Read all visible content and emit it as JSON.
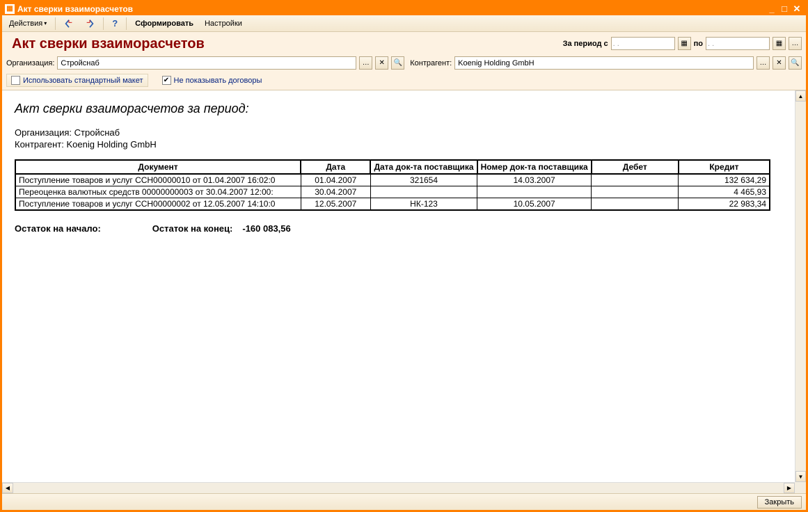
{
  "window": {
    "title": "Акт сверки взаиморасчетов"
  },
  "toolbar": {
    "actions": "Действия",
    "generate": "Сформировать",
    "settings": "Настройки"
  },
  "header": {
    "report_title": "Акт сверки взаиморасчетов",
    "period_label": "За период с",
    "po_label": "по",
    "date_from": "  .  .",
    "date_to": "  .  ."
  },
  "fields": {
    "org_label": "Организация:",
    "org_value": "Стройснаб",
    "contr_label": "Контрагент:",
    "contr_value": "Koenig Holding GmbH"
  },
  "checks": {
    "std_layout": "Использовать стандартный макет",
    "hide_contracts": "Не показывать договоры"
  },
  "report": {
    "title": "Акт сверки взаиморасчетов за период:",
    "org_line_label": "Организация:",
    "org_line_value": "Стройснаб",
    "contr_line_label": "Контрагент:",
    "contr_line_value": "Koenig Holding GmbH",
    "columns": {
      "doc": "Документ",
      "date": "Дата",
      "sup_date": "Дата док-та поставщика",
      "sup_num": "Номер док-та поставщика",
      "debit": "Дебет",
      "credit": "Кредит"
    },
    "rows": [
      {
        "doc": "Поступление товаров и услуг ССН00000010 от 01.04.2007 16:02:0",
        "date": "01.04.2007",
        "sup_date": "321654",
        "sup_num": "14.03.2007",
        "debit": "",
        "credit": "132 634,29"
      },
      {
        "doc": "Переоценка валютных средств 00000000003 от 30.04.2007 12:00:",
        "date": "30.04.2007",
        "sup_date": "",
        "sup_num": "",
        "debit": "",
        "credit": "4 465,93"
      },
      {
        "doc": "Поступление товаров и услуг ССН00000002 от 12.05.2007 14:10:0",
        "date": "12.05.2007",
        "sup_date": "НК-123",
        "sup_num": "10.05.2007",
        "debit": "",
        "credit": "22 983,34"
      }
    ],
    "balance_start_label": "Остаток на начало:",
    "balance_start_value": "",
    "balance_end_label": "Остаток на конец:",
    "balance_end_value": "-160 083,56"
  },
  "footer": {
    "close": "Закрыть"
  }
}
